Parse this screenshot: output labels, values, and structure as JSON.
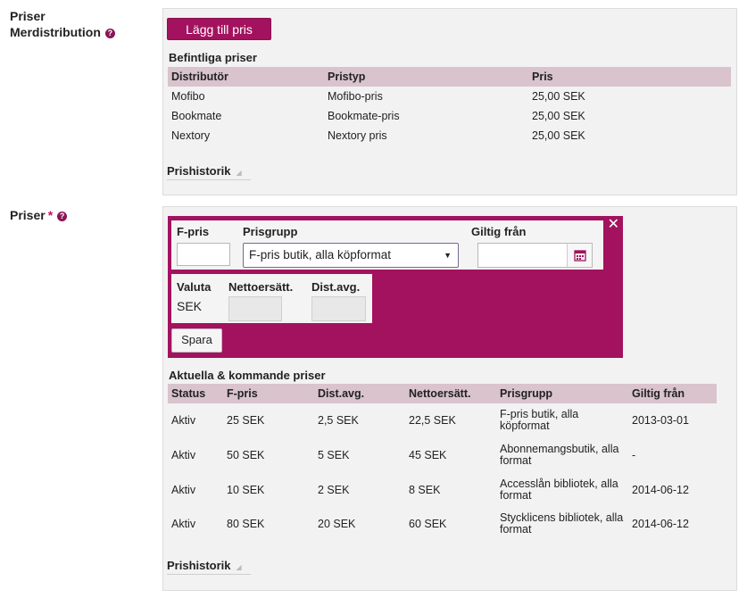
{
  "merdistribution": {
    "label_line1": "Priser",
    "label_line2": "Merdistribution",
    "help_glyph": "?",
    "add_button": "Lägg till pris",
    "existing_title": "Befintliga priser",
    "columns": [
      "Distributör",
      "Pristyp",
      "Pris"
    ],
    "rows": [
      [
        "Mofibo",
        "Mofibo-pris",
        "25,00 SEK"
      ],
      [
        "Bookmate",
        "Bookmate-pris",
        "25,00 SEK"
      ],
      [
        "Nextory",
        "Nextory pris",
        "25,00 SEK"
      ]
    ],
    "history_link": "Prishistorik"
  },
  "priser": {
    "label": "Priser",
    "required_mark": "*",
    "help_glyph": "?",
    "editor": {
      "close_glyph": "✕",
      "fpris_label": "F-pris",
      "fpris_value": "",
      "prisgrupp_label": "Prisgrupp",
      "prisgrupp_selected": "F-pris butik, alla köpformat",
      "giltig_label": "Giltig från",
      "giltig_value": "",
      "valuta_label": "Valuta",
      "valuta_value": "SEK",
      "netto_label": "Nettoersätt.",
      "dist_label": "Dist.avg.",
      "save_button": "Spara"
    },
    "current_title": "Aktuella & kommande priser",
    "columns": [
      "Status",
      "F-pris",
      "Dist.avg.",
      "Nettoersätt.",
      "Prisgrupp",
      "Giltig från"
    ],
    "rows": [
      [
        "Aktiv",
        "25 SEK",
        "2,5 SEK",
        "22,5 SEK",
        "F-pris butik, alla köpformat",
        "2013-03-01"
      ],
      [
        "Aktiv",
        "50 SEK",
        "5 SEK",
        "45 SEK",
        "Abonnemangsbutik, alla format",
        "-"
      ],
      [
        "Aktiv",
        "10 SEK",
        "2 SEK",
        "8 SEK",
        "Accesslån bibliotek, alla format",
        "2014-06-12"
      ],
      [
        "Aktiv",
        "80 SEK",
        "20 SEK",
        "60 SEK",
        "Stycklicens bibliotek, alla format",
        "2014-06-12"
      ]
    ],
    "history_link": "Prishistorik"
  },
  "colors": {
    "accent": "#a3125e",
    "table_header": "#d9c3cd",
    "panel_bg": "#f2f2f2"
  },
  "icons": {
    "help": "help-circle-icon",
    "close": "close-icon",
    "calendar": "calendar-icon",
    "dropdown": "chevron-down-icon",
    "collapse": "triangle-icon"
  }
}
